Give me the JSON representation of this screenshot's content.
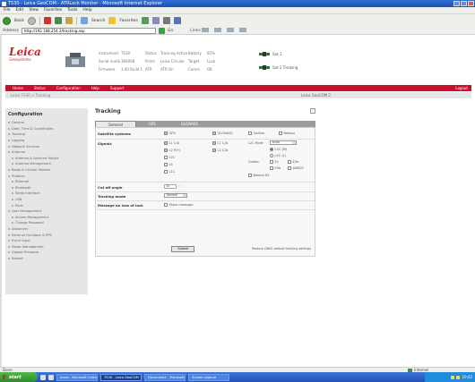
{
  "window": {
    "title": "TS30 - Leica GeoCOM - ATRLock Monitor - Microsoft Internet Explorer"
  },
  "menu": [
    "File",
    "Edit",
    "View",
    "Favorites",
    "Tools",
    "Help"
  ],
  "toolbar": {
    "back_label": "Back",
    "search_label": "Search",
    "favorites_label": "Favorites"
  },
  "address": {
    "label": "Address",
    "value": "http://192.168.254.3/tracking.asp",
    "go_label": "Go",
    "links_label": "Links"
  },
  "header": {
    "brand": "Leica",
    "brand_tag": "Geosystems",
    "status_rows": [
      [
        "Instrument",
        "TS30",
        "Status",
        "Tracking Active",
        "Battery",
        "85%"
      ],
      [
        "Serial number",
        "366098",
        "Prism",
        "Leica Circular",
        "Target",
        "Lock"
      ],
      [
        "Firmware",
        "3.00 Build 1",
        "ATR",
        "ATR On",
        "Comm",
        "OK"
      ]
    ],
    "sat_label_1": "Sat 1",
    "sat_label_2": "Sat 2 Tracking"
  },
  "nav": {
    "items": [
      "Home",
      "Status",
      "Configuration",
      "Help",
      "Support"
    ],
    "logout": "Logout",
    "breadcrumb": "Leica TS30 > Tracking",
    "instrument_label": "Leica GeoCOM 2"
  },
  "sidebar": {
    "title": "Configuration",
    "items": [
      {
        "label": "General",
        "indent": false
      },
      {
        "label": "Date, Time & Coordinates",
        "indent": false
      },
      {
        "label": "Tracking",
        "indent": false
      },
      {
        "label": "Logging",
        "indent": false
      },
      {
        "label": "Network Services",
        "indent": false
      },
      {
        "label": "Antenna",
        "indent": false
      },
      {
        "label": "Antenna & Antenna Height",
        "indent": true
      },
      {
        "label": "Antenna Management",
        "indent": true
      },
      {
        "label": "Radio & Cellular Modem",
        "indent": false
      },
      {
        "label": "Protocol",
        "indent": false
      },
      {
        "label": "Ethernet",
        "indent": true
      },
      {
        "label": "Bluetooth",
        "indent": true
      },
      {
        "label": "Serial Interface",
        "indent": true
      },
      {
        "label": "USB",
        "indent": true
      },
      {
        "label": "Ports",
        "indent": true
      },
      {
        "label": "User Management",
        "indent": false
      },
      {
        "label": "Access Management",
        "indent": true
      },
      {
        "label": "Change Password",
        "indent": true
      },
      {
        "label": "Advanced",
        "indent": false
      },
      {
        "label": "External Oscillator & PPS",
        "indent": false
      },
      {
        "label": "Event Input",
        "indent": false
      },
      {
        "label": "Power Management",
        "indent": false
      },
      {
        "label": "Upload Firmware",
        "indent": false
      },
      {
        "label": "Reboot",
        "indent": false
      }
    ]
  },
  "main": {
    "title": "Tracking",
    "help": "?",
    "tabs": [
      "General",
      "GPS",
      "GLONASS"
    ],
    "satellite_systems_label": "Satellite systems",
    "systems": [
      "GPS",
      "GLONASS",
      "Galileo",
      "Beidou"
    ],
    "signals_label": "Signals",
    "gps_signals": [
      "L1 C/A",
      "L2 P(Y)",
      "L2C",
      "L5",
      "L1C"
    ],
    "glonass_signals": [
      "L1 C/A",
      "L2 C/A"
    ],
    "gps_signal_extras": [
      "L2C Mode",
      "Auto",
      "L2C (M)",
      "L2C (L)"
    ],
    "galileo_label": "Galileo",
    "galileo_extras": [
      "E1",
      "E5a",
      "E5b",
      "AltBOC"
    ],
    "beidou_label": "Beidou B1",
    "cutoff_label": "Cut off angle",
    "cutoff_value": "10",
    "cutoff_unit": "°",
    "tracking_mode_label": "Tracking mode",
    "tracking_mode_value": "Normal",
    "msg_label": "Message on loss of lock",
    "msg_option": "Show message",
    "submit": "Submit",
    "restore": "Restore GNSS default tracking settings"
  },
  "statusbar": {
    "status": "Done",
    "zone": "Internet"
  },
  "taskbar": {
    "start": "start",
    "tasks": [
      "Inbox - Microsoft Outlook",
      "TS30 - Leica GeoCOM",
      "Document1 - Microsoft Word",
      "Screen capture"
    ],
    "active_task_index": 1,
    "clock": "10:42"
  }
}
